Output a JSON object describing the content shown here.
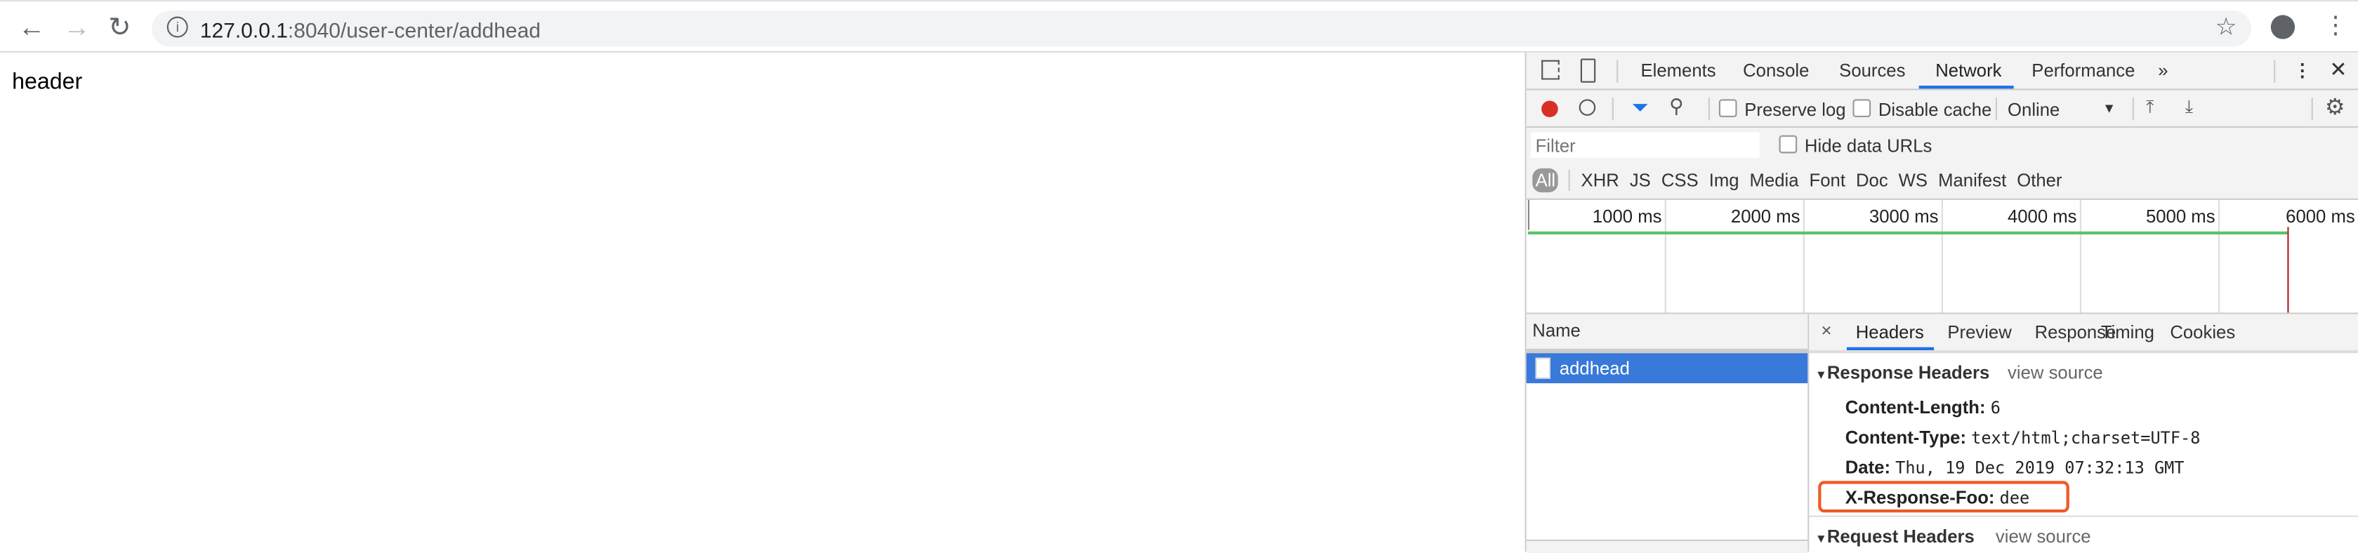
{
  "browser": {
    "url_host": "127.0.0.1",
    "url_path": ":8040/user-center/addhead",
    "icons": [
      "back-icon",
      "forward-icon",
      "reload-icon",
      "info-icon",
      "star-icon",
      "account-icon",
      "menu-icon"
    ]
  },
  "page": {
    "text": "header"
  },
  "devtools": {
    "tabs": [
      "Elements",
      "Console",
      "Sources",
      "Network",
      "Performance"
    ],
    "active_tab": "Network",
    "more": "»",
    "toolbar": {
      "preserve_log": "Preserve log",
      "disable_cache": "Disable cache",
      "throttle": "Online",
      "preserve_checked": false,
      "cache_checked": false
    },
    "filter": {
      "placeholder": "Filter",
      "hide_data_urls": "Hide data URLs"
    },
    "types": [
      "All",
      "XHR",
      "JS",
      "CSS",
      "Img",
      "Media",
      "Font",
      "Doc",
      "WS",
      "Manifest",
      "Other"
    ],
    "timeline": {
      "ticks": [
        "1000 ms",
        "2000 ms",
        "3000 ms",
        "4000 ms",
        "5000 ms",
        "6000 ms"
      ],
      "colors": {
        "bar": "#5bc46a",
        "load": "#b22222"
      }
    },
    "name_header": "Name",
    "requests": [
      {
        "name": "addhead",
        "selected": true
      }
    ],
    "detail_tabs": [
      "Headers",
      "Preview",
      "Response",
      "Timing",
      "Cookies"
    ],
    "close": "×",
    "response_headers": {
      "title": "Response Headers",
      "view_source": "view source",
      "items": [
        {
          "key": "Content-Length:",
          "value": "6"
        },
        {
          "key": "Content-Type:",
          "value": "text/html;charset=UTF-8"
        },
        {
          "key": "Date:",
          "value": "Thu, 19 Dec 2019 07:32:13 GMT"
        },
        {
          "key": "X-Response-Foo:",
          "value": "dee"
        }
      ]
    },
    "request_headers": {
      "title": "Request Headers",
      "view_source": "view source"
    },
    "colors": {
      "accent": "#1a73e8",
      "selected_row": "#3879d9",
      "highlight_box": "#f05a28",
      "record": "#d93025"
    }
  }
}
